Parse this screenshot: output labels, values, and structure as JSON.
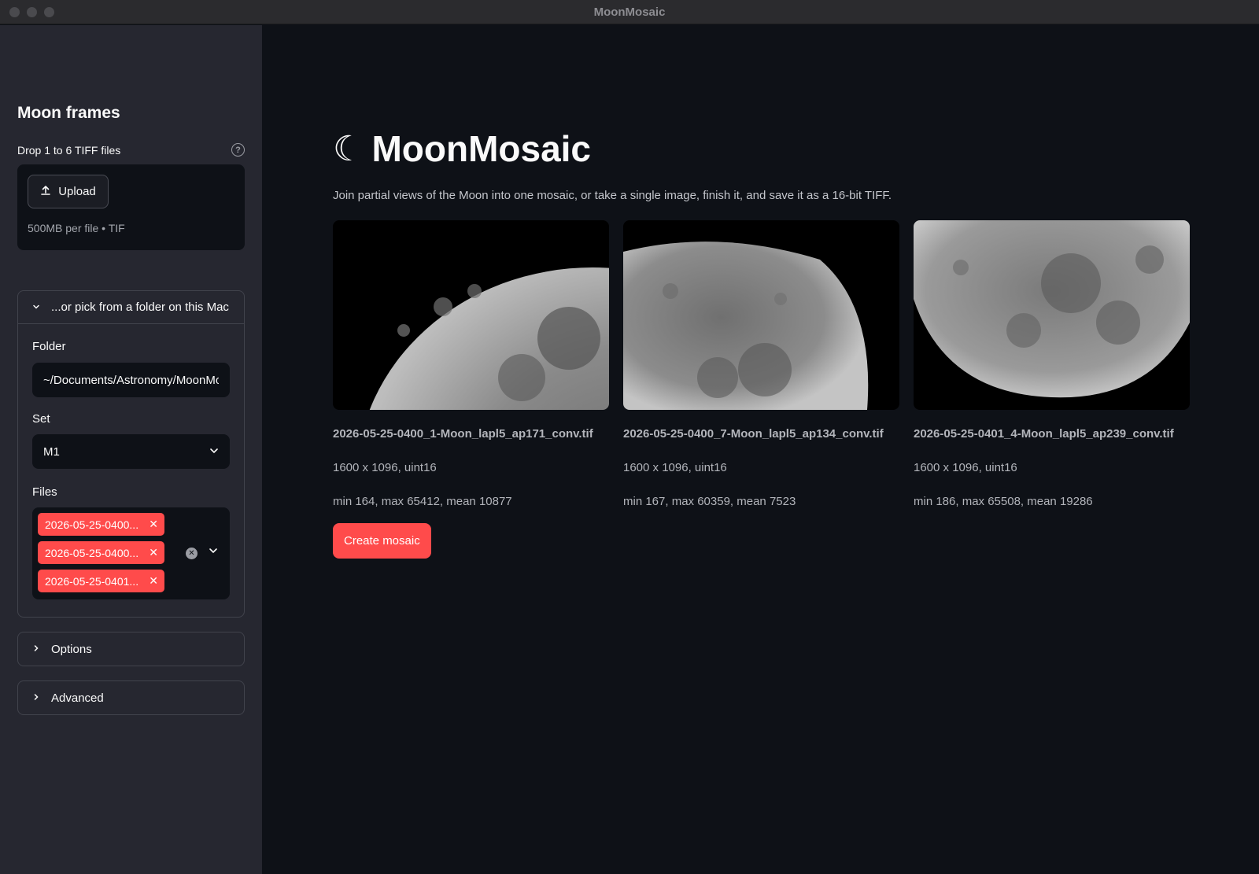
{
  "window": {
    "title": "MoonMosaic"
  },
  "sidebar": {
    "heading": "Moon frames",
    "uploader": {
      "label": "Drop 1 to 6 TIFF files",
      "button_label": "Upload",
      "limit_text": "500MB per file • TIF"
    },
    "folder_expander": {
      "label": "...or pick from a folder on this Mac",
      "folder_label": "Folder",
      "folder_value": "~/Documents/Astronomy/MoonMosaic",
      "set_label": "Set",
      "set_value": "M1",
      "files_label": "Files",
      "files": [
        "2026-05-25-0400_1-Moon_lapl5_ap171_conv.tif",
        "2026-05-25-0400_7-Moon_lapl5_ap134_conv.tif",
        "2026-05-25-0401_4-Moon_lapl5_ap239_conv.tif"
      ],
      "files_display": [
        "2026-05-25-0400...",
        "2026-05-25-0400...",
        "2026-05-25-0401..."
      ]
    },
    "options_label": "Options",
    "advanced_label": "Advanced"
  },
  "main": {
    "title_glyph": "☾",
    "title": "MoonMosaic",
    "subtitle": "Join partial views of the Moon into one mosaic, or take a single image, finish it, and save it as a 16-bit TIFF.",
    "frames": [
      {
        "name": "2026-05-25-0400_1-Moon_lapl5_ap171_conv.tif",
        "dims": "1600 x 1096, uint16",
        "stats": "min 164, max 65412, mean 10877"
      },
      {
        "name": "2026-05-25-0400_7-Moon_lapl5_ap134_conv.tif",
        "dims": "1600 x 1096, uint16",
        "stats": "min 167, max 60359, mean 7523"
      },
      {
        "name": "2026-05-25-0401_4-Moon_lapl5_ap239_conv.tif",
        "dims": "1600 x 1096, uint16",
        "stats": "min 186, max 65508, mean 19286"
      }
    ],
    "create_button_label": "Create mosaic"
  },
  "colors": {
    "accent": "#ff4b4b",
    "background": "#0e1117",
    "sidebar": "#262730"
  }
}
